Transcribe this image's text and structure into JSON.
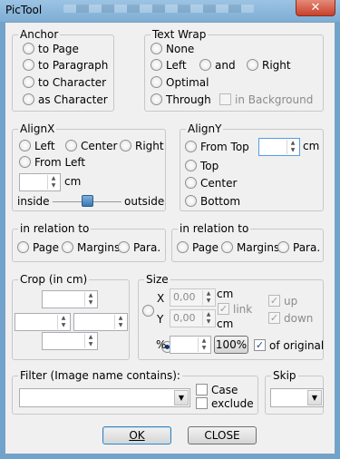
{
  "window": {
    "title": "PicTool",
    "close_glyph": "✕"
  },
  "anchor": {
    "legend": "Anchor",
    "options": [
      "to Page",
      "to Paragraph",
      "to Character",
      "as Character"
    ]
  },
  "wrap": {
    "legend": "Text Wrap",
    "none": "None",
    "left": "Left",
    "and": "and",
    "right": "Right",
    "optimal": "Optimal",
    "through": "Through",
    "background": "in Background"
  },
  "alignx": {
    "legend": "AlignX",
    "left": "Left",
    "center": "Center",
    "right": "Right",
    "from_left": "From Left",
    "unit": "cm",
    "inside": "inside",
    "outside": "outside"
  },
  "aligny": {
    "legend": "AlignY",
    "from_top": "From Top",
    "unit": "cm",
    "top": "Top",
    "center": "Center",
    "bottom": "Bottom"
  },
  "relation_x": {
    "legend": "in relation to",
    "page": "Page",
    "margins": "Margins",
    "para": "Para."
  },
  "relation_y": {
    "legend": "in relation to",
    "page": "Page",
    "margins": "Margins",
    "para": "Para."
  },
  "crop": {
    "legend": "Crop (in cm)"
  },
  "size": {
    "legend": "Size",
    "x_label": "X",
    "y_label": "Y",
    "x_value": "0,00",
    "y_value": "0,00",
    "unit_x": "cm",
    "unit_y": "cm",
    "link": "link",
    "up": "up",
    "down": "down",
    "percent_label": "%",
    "percent_button": "100%",
    "of_original": "of original"
  },
  "filter": {
    "legend": "Filter (Image name contains):",
    "case": "Case",
    "exclude": "exclude"
  },
  "skip": {
    "legend": "Skip"
  },
  "buttons": {
    "ok": "OK",
    "close": "CLOSE"
  }
}
